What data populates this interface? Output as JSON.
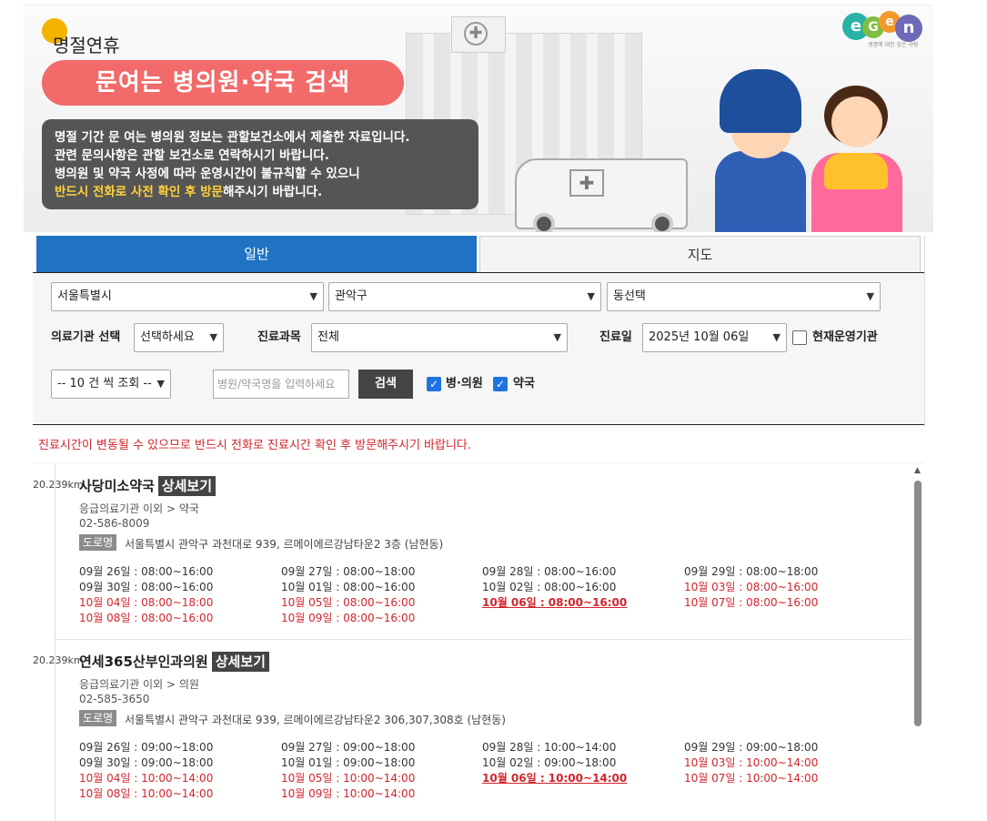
{
  "banner": {
    "holiday_label": "명절연휴",
    "title": "문여는 병의원·약국 검색",
    "notice_lines": [
      "명절 기간 문 여는 병의원 정보는 관할보건소에서 제출한 자료입니다.",
      "관련 문의사항은 관할 보건소로 연락하시기 바랍니다.",
      "병의원 및 약국 사정에 따라 운영시간이 불규칙할 수 있으니"
    ],
    "notice_highlight": "반드시 전화로 사전 확인 후 방문",
    "notice_tail": "해주시기 바랍니다.",
    "logo_sub": "생명에 대한 깊은 사랑"
  },
  "tabs": [
    {
      "label": "일반",
      "active": true
    },
    {
      "label": "지도",
      "active": false
    }
  ],
  "filters": {
    "city": "서울특별시",
    "district": "관악구",
    "dong": "동선택",
    "institution_label": "의료기관 선택",
    "institution_value": "선택하세요",
    "subject_label": "진료과목",
    "subject_value": "전체",
    "date_label": "진료일",
    "date_value": "2025년 10월 06일",
    "open_now_label": "현재운영기관",
    "page_size": "-- 10 건 씩 조회 --",
    "search_placeholder": "병원/약국명을 입력하세요",
    "search_button": "검색",
    "hospital_label": "병·의원",
    "pharmacy_label": "약국"
  },
  "warning": "진료시간이 변동될 수 있으므로 반드시 전화로 진료시간 확인 후 방문해주시기 바랍니다.",
  "results": [
    {
      "distance": "20.239km",
      "name": "사당미소약국",
      "detail_label": "상세보기",
      "type": "응급의료기관 이외 > 약국",
      "phone": "02-586-8009",
      "road_label": "도로명",
      "address": "서울특별시 관악구 과천대로 939, 르메이에르강남타운2 3층 (남현동)",
      "hours": [
        {
          "text": "09월 26일 : 08:00~16:00",
          "style": "normal"
        },
        {
          "text": "09월 27일 : 08:00~18:00",
          "style": "normal"
        },
        {
          "text": "09월 28일 : 08:00~16:00",
          "style": "normal"
        },
        {
          "text": "09월 29일 : 08:00~18:00",
          "style": "normal"
        },
        {
          "text": "09월 30일 : 08:00~16:00",
          "style": "normal"
        },
        {
          "text": "10월 01일 : 08:00~16:00",
          "style": "normal"
        },
        {
          "text": "10월 02일 : 08:00~16:00",
          "style": "normal"
        },
        {
          "text": "10월 03일 : 08:00~16:00",
          "style": "red"
        },
        {
          "text": "10월 04일 : 08:00~18:00",
          "style": "red"
        },
        {
          "text": "10월 05일 : 08:00~16:00",
          "style": "red"
        },
        {
          "text": "10월 06일 : 08:00~16:00",
          "style": "today"
        },
        {
          "text": "10월 07일 : 08:00~16:00",
          "style": "red"
        },
        {
          "text": "10월 08일 : 08:00~16:00",
          "style": "red"
        },
        {
          "text": "10월 09일 : 08:00~16:00",
          "style": "red"
        }
      ]
    },
    {
      "distance": "20.239km",
      "name": "연세365산부인과의원",
      "detail_label": "상세보기",
      "type": "응급의료기관 이외 > 의원",
      "phone": "02-585-3650",
      "road_label": "도로명",
      "address": "서울특별시 관악구 과천대로 939, 르메이에르강남타운2 306,307,308호 (남현동)",
      "hours": [
        {
          "text": "09월 26일 : 09:00~18:00",
          "style": "normal"
        },
        {
          "text": "09월 27일 : 09:00~18:00",
          "style": "normal"
        },
        {
          "text": "09월 28일 : 10:00~14:00",
          "style": "normal"
        },
        {
          "text": "09월 29일 : 09:00~18:00",
          "style": "normal"
        },
        {
          "text": "09월 30일 : 09:00~18:00",
          "style": "normal"
        },
        {
          "text": "10월 01일 : 09:00~18:00",
          "style": "normal"
        },
        {
          "text": "10월 02일 : 09:00~18:00",
          "style": "normal"
        },
        {
          "text": "10월 03일 : 10:00~14:00",
          "style": "red"
        },
        {
          "text": "10월 04일 : 10:00~14:00",
          "style": "red"
        },
        {
          "text": "10월 05일 : 10:00~14:00",
          "style": "red"
        },
        {
          "text": "10월 06일 : 10:00~14:00",
          "style": "today"
        },
        {
          "text": "10월 07일 : 10:00~14:00",
          "style": "red"
        },
        {
          "text": "10월 08일 : 10:00~14:00",
          "style": "red"
        },
        {
          "text": "10월 09일 : 10:00~14:00",
          "style": "red"
        }
      ]
    }
  ],
  "colors": {
    "accent_blue": "#1f73c2",
    "title_pink": "#f26a6a",
    "warning_red": "#d2242b",
    "highlight_yellow": "#ffd23c"
  }
}
